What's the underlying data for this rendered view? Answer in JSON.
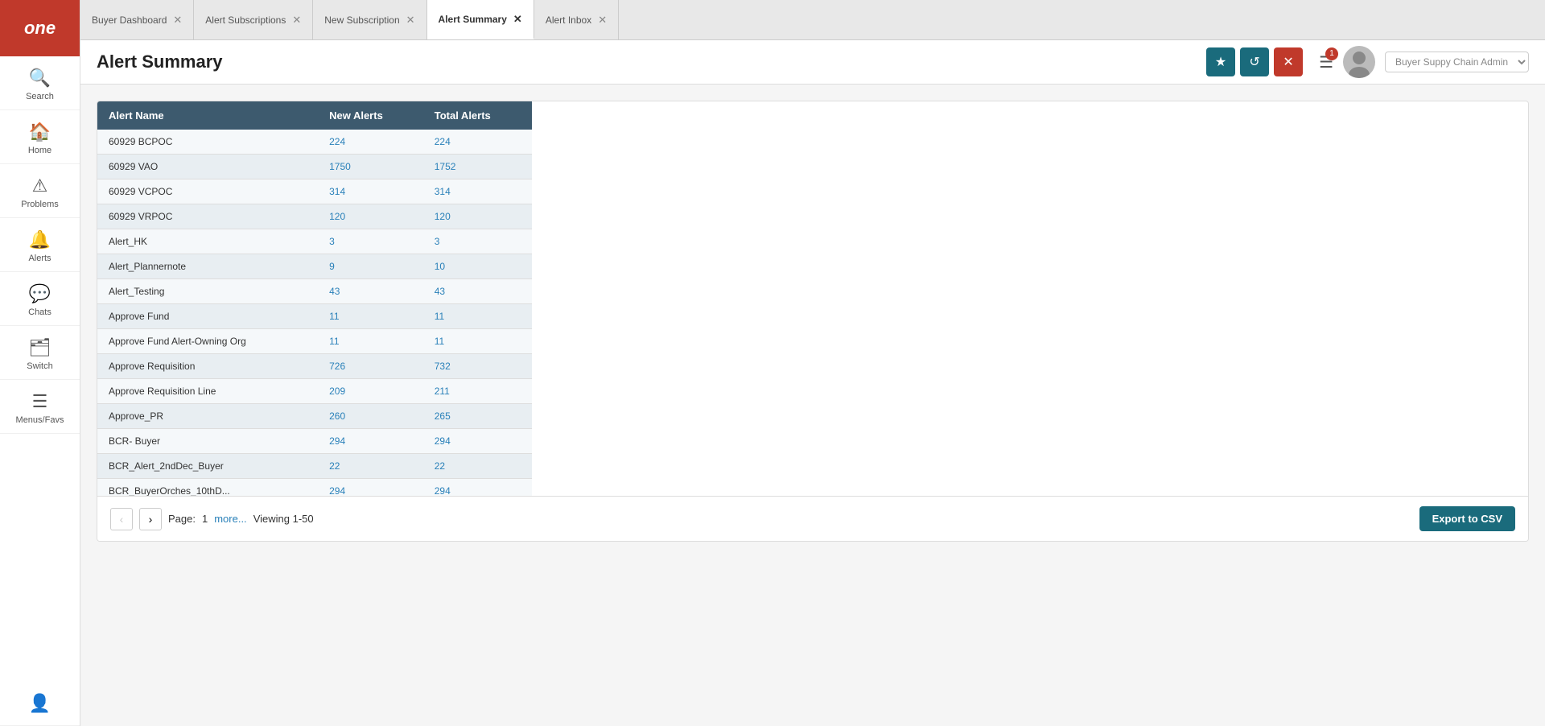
{
  "app": {
    "logo": "one"
  },
  "sidebar": {
    "items": [
      {
        "id": "search",
        "label": "Search",
        "icon": "🔍"
      },
      {
        "id": "home",
        "label": "Home",
        "icon": "🏠"
      },
      {
        "id": "problems",
        "label": "Problems",
        "icon": "⚠"
      },
      {
        "id": "alerts",
        "label": "Alerts",
        "icon": "🔔"
      },
      {
        "id": "chats",
        "label": "Chats",
        "icon": "💬"
      },
      {
        "id": "switch",
        "label": "Switch",
        "icon": "🗂"
      },
      {
        "id": "menus-favs",
        "label": "Menus/Favs",
        "icon": "☰"
      },
      {
        "id": "user-avatar",
        "label": "",
        "icon": "👤"
      }
    ]
  },
  "tabs": [
    {
      "id": "buyer-dashboard",
      "label": "Buyer Dashboard",
      "active": false
    },
    {
      "id": "alert-subscriptions",
      "label": "Alert Subscriptions",
      "active": false
    },
    {
      "id": "new-subscription",
      "label": "New Subscription",
      "active": false
    },
    {
      "id": "alert-summary",
      "label": "Alert Summary",
      "active": true
    },
    {
      "id": "alert-inbox",
      "label": "Alert Inbox",
      "active": false
    }
  ],
  "header": {
    "title": "Alert Summary",
    "star_btn": "★",
    "refresh_btn": "↺",
    "close_btn": "✕",
    "menu_btn": "☰",
    "notification_count": "1",
    "user_role": "Buyer Suppy Chain Admin"
  },
  "table": {
    "columns": [
      {
        "id": "alert-name",
        "label": "Alert Name"
      },
      {
        "id": "new-alerts",
        "label": "New Alerts"
      },
      {
        "id": "total-alerts",
        "label": "Total Alerts"
      }
    ],
    "rows": [
      {
        "name": "60929 BCPOC",
        "new": "224",
        "total": "224"
      },
      {
        "name": "60929 VAO",
        "new": "1750",
        "total": "1752"
      },
      {
        "name": "60929 VCPOC",
        "new": "314",
        "total": "314"
      },
      {
        "name": "60929 VRPOC",
        "new": "120",
        "total": "120"
      },
      {
        "name": "Alert_HK",
        "new": "3",
        "total": "3"
      },
      {
        "name": "Alert_Plannernote",
        "new": "9",
        "total": "10"
      },
      {
        "name": "Alert_Testing",
        "new": "43",
        "total": "43"
      },
      {
        "name": "Approve Fund",
        "new": "11",
        "total": "11"
      },
      {
        "name": "Approve Fund Alert-Owning Org",
        "new": "11",
        "total": "11"
      },
      {
        "name": "Approve Requisition",
        "new": "726",
        "total": "732"
      },
      {
        "name": "Approve Requisition Line",
        "new": "209",
        "total": "211"
      },
      {
        "name": "Approve_PR",
        "new": "260",
        "total": "265"
      },
      {
        "name": "BCR- Buyer",
        "new": "294",
        "total": "294"
      },
      {
        "name": "BCR_Alert_2ndDec_Buyer",
        "new": "22",
        "total": "22"
      },
      {
        "name": "BCR_BuyerOrches_10thD...",
        "new": "294",
        "total": "294"
      }
    ]
  },
  "pagination": {
    "current_page": "1",
    "more_label": "more...",
    "viewing": "Viewing 1-50",
    "prev_disabled": true,
    "next_disabled": false,
    "export_btn": "Export to CSV"
  }
}
